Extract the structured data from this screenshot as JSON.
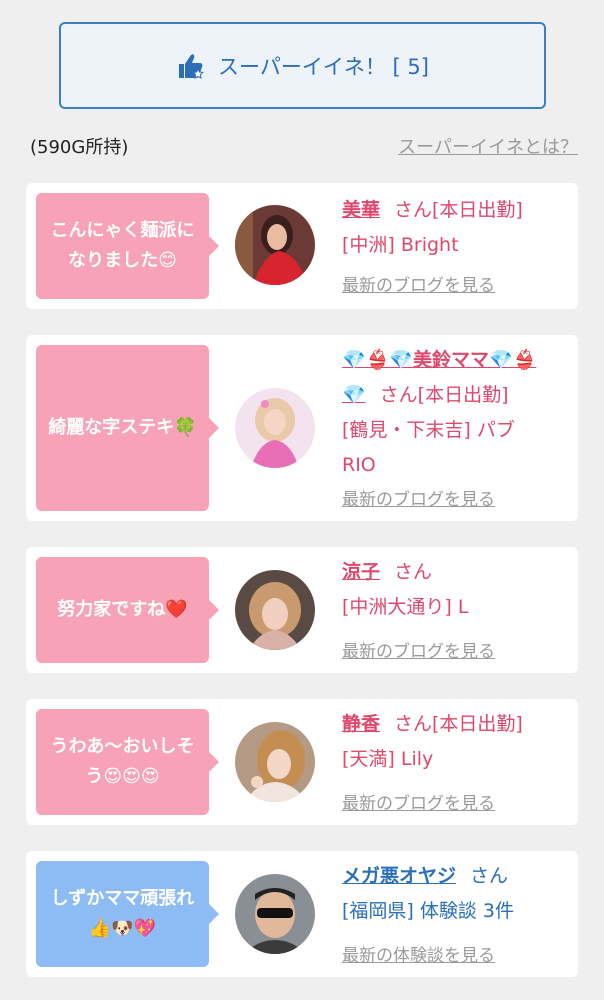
{
  "super_button": {
    "label": "スーパーイイネ！ [ 5]",
    "icon": "thumbs-up-star-icon"
  },
  "owned_text": "(590G所持)",
  "what_is_link": "スーパーイイネとは？",
  "cards": [
    {
      "comment_line1": "こんにゃく麺派に",
      "comment_line2": "なりました😊",
      "name": "美華",
      "san": "さん[本日出勤]",
      "shop_line1": "[中洲] Bright",
      "shop_line2": "",
      "link": "最新のブログを見る",
      "theme": "pink"
    },
    {
      "comment_line1": "綺麗な字ステキ🍀",
      "comment_line2": "",
      "name": "💎👙💎美鈴ママ💎👙",
      "name_cont": "💎",
      "san": "さん[本日出勤]",
      "shop_line1": "[鶴見・下末吉] パブ",
      "shop_line2": "RIO",
      "link": "最新のブログを見る",
      "theme": "pink"
    },
    {
      "comment_line1": "努力家ですね❤️",
      "comment_line2": "",
      "name": "涼子",
      "san": "さん",
      "shop_line1": "[中洲大通り] L",
      "shop_line2": "",
      "link": "最新のブログを見る",
      "theme": "pink"
    },
    {
      "comment_line1": "うわあ〜おいしそ",
      "comment_line2": "う😍😍😍",
      "name": "静香",
      "san": "さん[本日出勤]",
      "shop_line1": "[天満] Lily",
      "shop_line2": "",
      "link": "最新のブログを見る",
      "theme": "pink"
    },
    {
      "comment_line1": "しずかママ頑張れ",
      "comment_line2": "👍🐶💖",
      "name": "メガ悪オヤジ",
      "san": "さん",
      "shop_line1": "[福岡県] 体験談 3件",
      "shop_line2": "",
      "link": "最新の体験談を見る",
      "theme": "blue"
    }
  ],
  "colors": {
    "pink_text": "#e0476c",
    "blue_text": "#2a6fb8",
    "pink_bubble": "#f7a2b6",
    "blue_bubble": "#8cbcf3",
    "button_border": "#3d7ec0"
  }
}
